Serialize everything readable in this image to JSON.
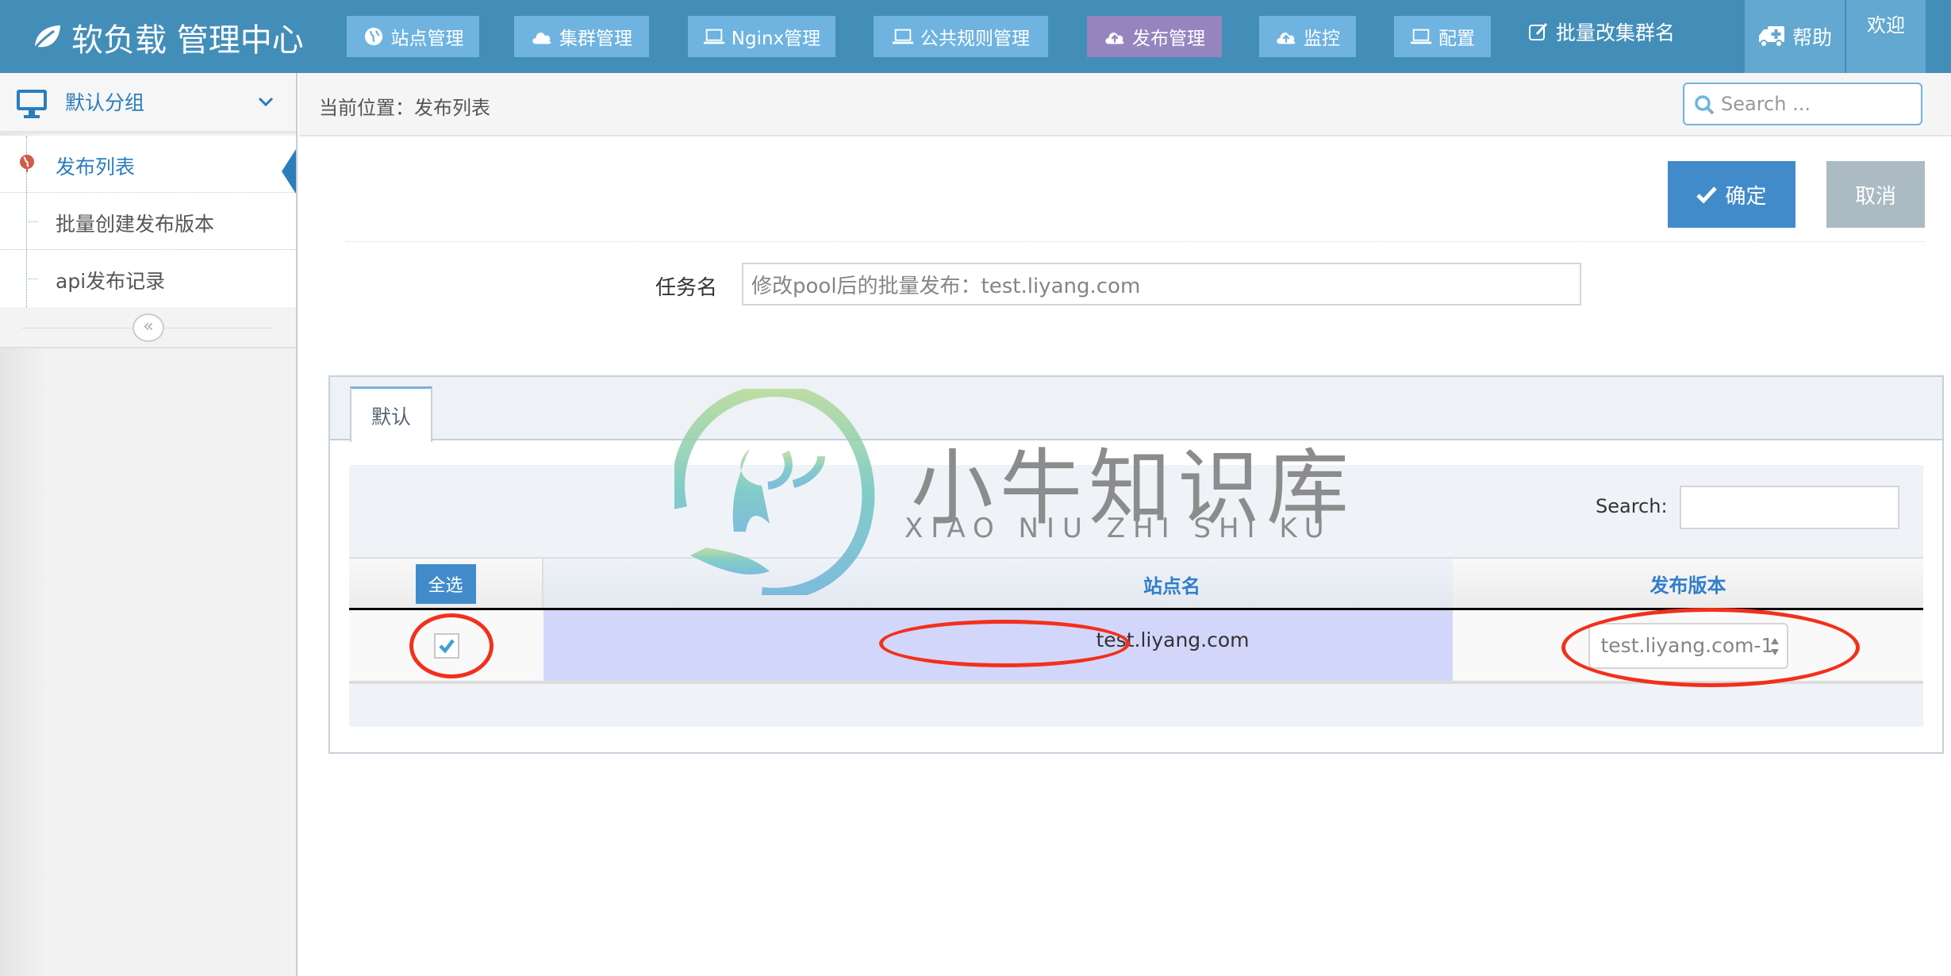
{
  "header": {
    "brand": "软负载 管理中心",
    "nav": [
      {
        "label": "站点管理",
        "icon": "globe-icon"
      },
      {
        "label": "集群管理",
        "icon": "cloud-icon"
      },
      {
        "label": "Nginx管理",
        "icon": "laptop-icon"
      },
      {
        "label": "公共规则管理",
        "icon": "laptop-icon"
      },
      {
        "label": "发布管理",
        "icon": "cloud-upload-icon",
        "active": true
      },
      {
        "label": "监控",
        "icon": "cloud-upload-icon"
      },
      {
        "label": "配置",
        "icon": "laptop-icon"
      }
    ],
    "batch_rename": "批量改集群名",
    "help": "帮助",
    "welcome": "欢迎"
  },
  "sidebar": {
    "group_label": "默认分组",
    "items": [
      {
        "label": "发布列表",
        "active": true
      },
      {
        "label": "批量创建发布版本"
      },
      {
        "label": "api发布记录"
      }
    ],
    "collapse_icon": "«"
  },
  "breadcrumb": {
    "text": "当前位置：发布列表"
  },
  "nav_search": {
    "placeholder": "Search ..."
  },
  "actions": {
    "confirm": "确定",
    "cancel": "取消"
  },
  "form": {
    "task_name_label": "任务名",
    "task_name_value": "修改pool后的批量发布：test.liyang.com"
  },
  "tabs": [
    {
      "label": "默认",
      "active": true
    }
  ],
  "table": {
    "search_label": "Search:",
    "search_value": "",
    "select_all": "全选",
    "columns": [
      "站点名",
      "发布版本"
    ],
    "sort": {
      "column": "站点名",
      "direction": "asc"
    },
    "rows": [
      {
        "checked": true,
        "site": "test.liyang.com",
        "version": "test.liyang.com-1"
      }
    ]
  },
  "watermark": {
    "title": "小牛知识库",
    "subtitle": "XIAO NIU ZHI SHI KU"
  },
  "colors": {
    "header_bg": "#438EB9",
    "nav_btn": "#6FB3E0",
    "nav_active": "#9585BF",
    "primary": "#428BCA",
    "cancel": "#ABBAC3",
    "row_highlight": "#D3D6FB",
    "annotation": "#F2301B"
  }
}
